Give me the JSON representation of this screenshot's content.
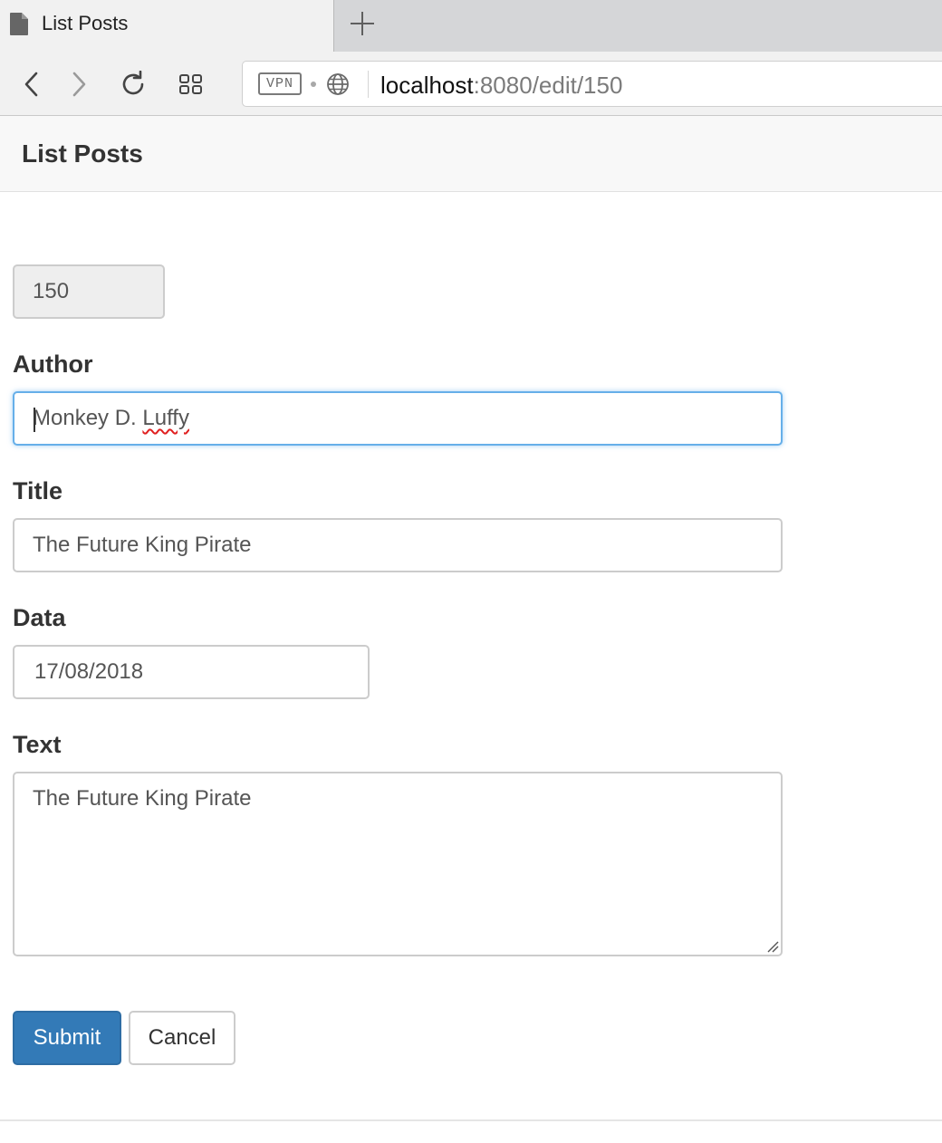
{
  "browser": {
    "tab_title": "List Posts",
    "tab_icon": "document-icon",
    "new_tab_icon": "plus-icon",
    "vpn_label": "VPN",
    "url_host": "localhost",
    "url_rest": ":8080/edit/150",
    "nav_icons": [
      "back-arrow-icon",
      "forward-arrow-icon",
      "reload-icon",
      "grid-icon",
      "globe-icon"
    ]
  },
  "navbar": {
    "brand": "List Posts"
  },
  "form": {
    "id_value": "150",
    "author_label": "Author",
    "author_value": "Monkey D. ",
    "author_value_misspelled": "Luffy",
    "title_label": "Title",
    "title_value": "The Future King Pirate",
    "data_label": "Data",
    "data_value": "17/08/2018",
    "text_label": "Text",
    "text_value": "The Future King Pirate",
    "submit_label": "Submit",
    "cancel_label": "Cancel"
  },
  "colors": {
    "primary": "#337ab7",
    "focus_border": "#66afe9",
    "spellcheck": "#e02020"
  }
}
